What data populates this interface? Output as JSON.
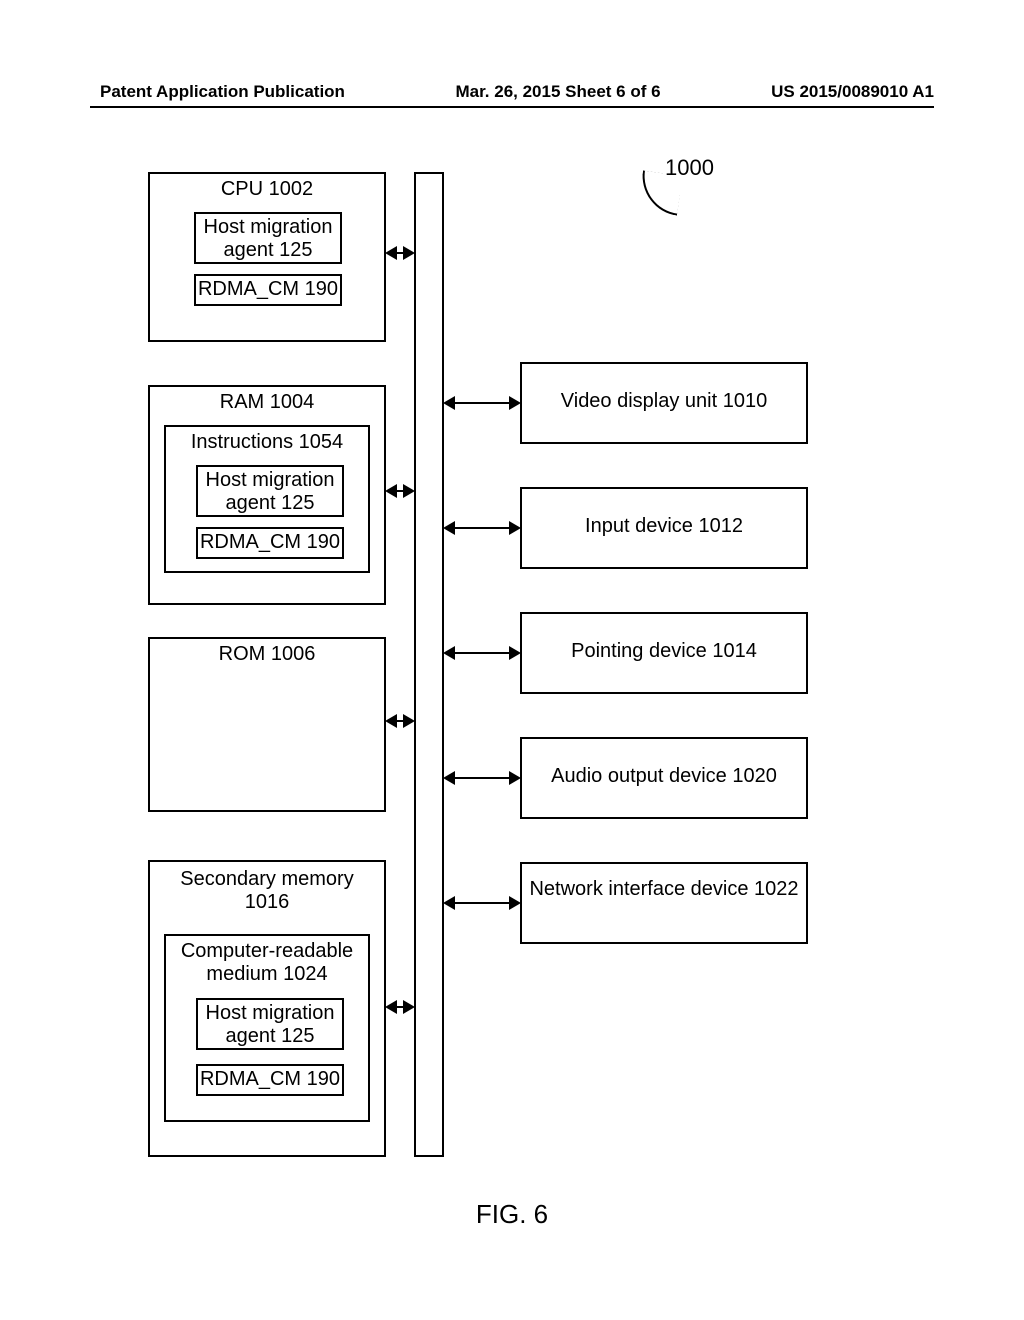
{
  "header": {
    "left": "Patent Application Publication",
    "center": "Mar. 26, 2015  Sheet 6 of 6",
    "right": "US 2015/0089010 A1"
  },
  "diagram": {
    "ref_number": "1000",
    "cpu": {
      "title": "CPU 1002",
      "host_migration": "Host migration agent 125",
      "rdma": "RDMA_CM 190"
    },
    "ram": {
      "title": "RAM 1004",
      "instructions": "Instructions 1054",
      "host_migration": "Host migration agent 125",
      "rdma": "RDMA_CM 190"
    },
    "rom": {
      "title": "ROM 1006"
    },
    "secondary": {
      "title": "Secondary memory 1016",
      "medium": "Computer-readable medium 1024",
      "host_migration": "Host migration agent 125",
      "rdma": "RDMA_CM 190"
    },
    "right_boxes": {
      "video": "Video display unit 1010",
      "input": "Input device 1012",
      "pointing": "Pointing device 1014",
      "audio": "Audio output device 1020",
      "network": "Network interface device 1022"
    },
    "caption": "FIG. 6"
  }
}
